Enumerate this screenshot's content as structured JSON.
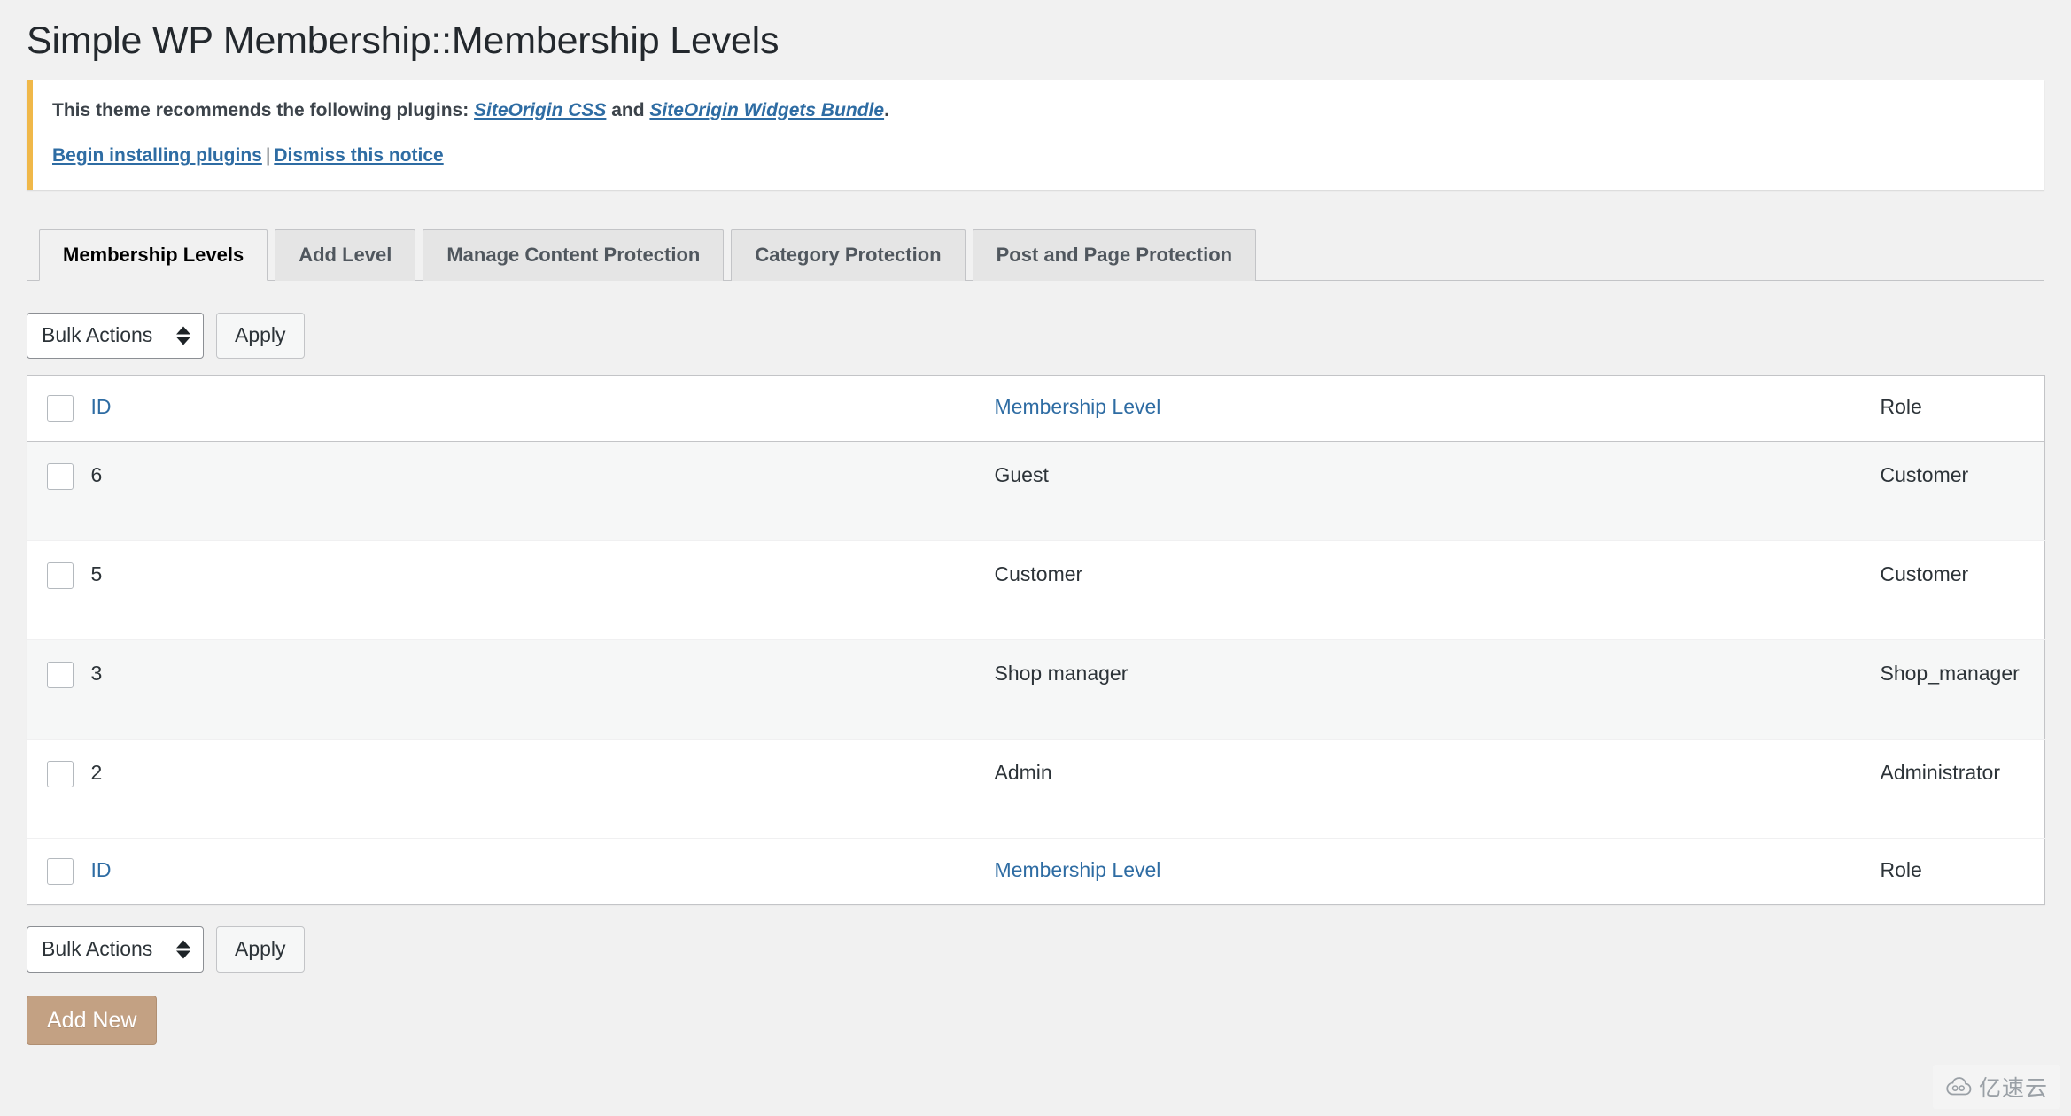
{
  "page": {
    "title": "Simple WP Membership::Membership Levels"
  },
  "notice": {
    "accent_color": "#f0b849",
    "line1_prefix": "This theme recommends the following plugins: ",
    "link1": "SiteOrigin CSS",
    "line1_mid": " and ",
    "link2": "SiteOrigin Widgets Bundle",
    "line1_suffix": ".",
    "action1": "Begin installing plugins",
    "separator": "|",
    "action2": "Dismiss this notice"
  },
  "tabs": [
    {
      "label": "Membership Levels",
      "active": true
    },
    {
      "label": "Add Level",
      "active": false
    },
    {
      "label": "Manage Content Protection",
      "active": false
    },
    {
      "label": "Category Protection",
      "active": false
    },
    {
      "label": "Post and Page Protection",
      "active": false
    }
  ],
  "tablenav": {
    "bulk_actions_label": "Bulk Actions",
    "apply_label": "Apply"
  },
  "table": {
    "columns": {
      "id": "ID",
      "level": "Membership Level",
      "role": "Role"
    },
    "rows": [
      {
        "id": "6",
        "level": "Guest",
        "role": "Customer"
      },
      {
        "id": "5",
        "level": "Customer",
        "role": "Customer"
      },
      {
        "id": "3",
        "level": "Shop manager",
        "role": "Shop_manager"
      },
      {
        "id": "2",
        "level": "Admin",
        "role": "Administrator"
      }
    ]
  },
  "actions": {
    "add_new_label": "Add New",
    "add_new_color": "#c3a183"
  },
  "watermark": {
    "text": "亿速云",
    "icon": "cloud-icon"
  }
}
